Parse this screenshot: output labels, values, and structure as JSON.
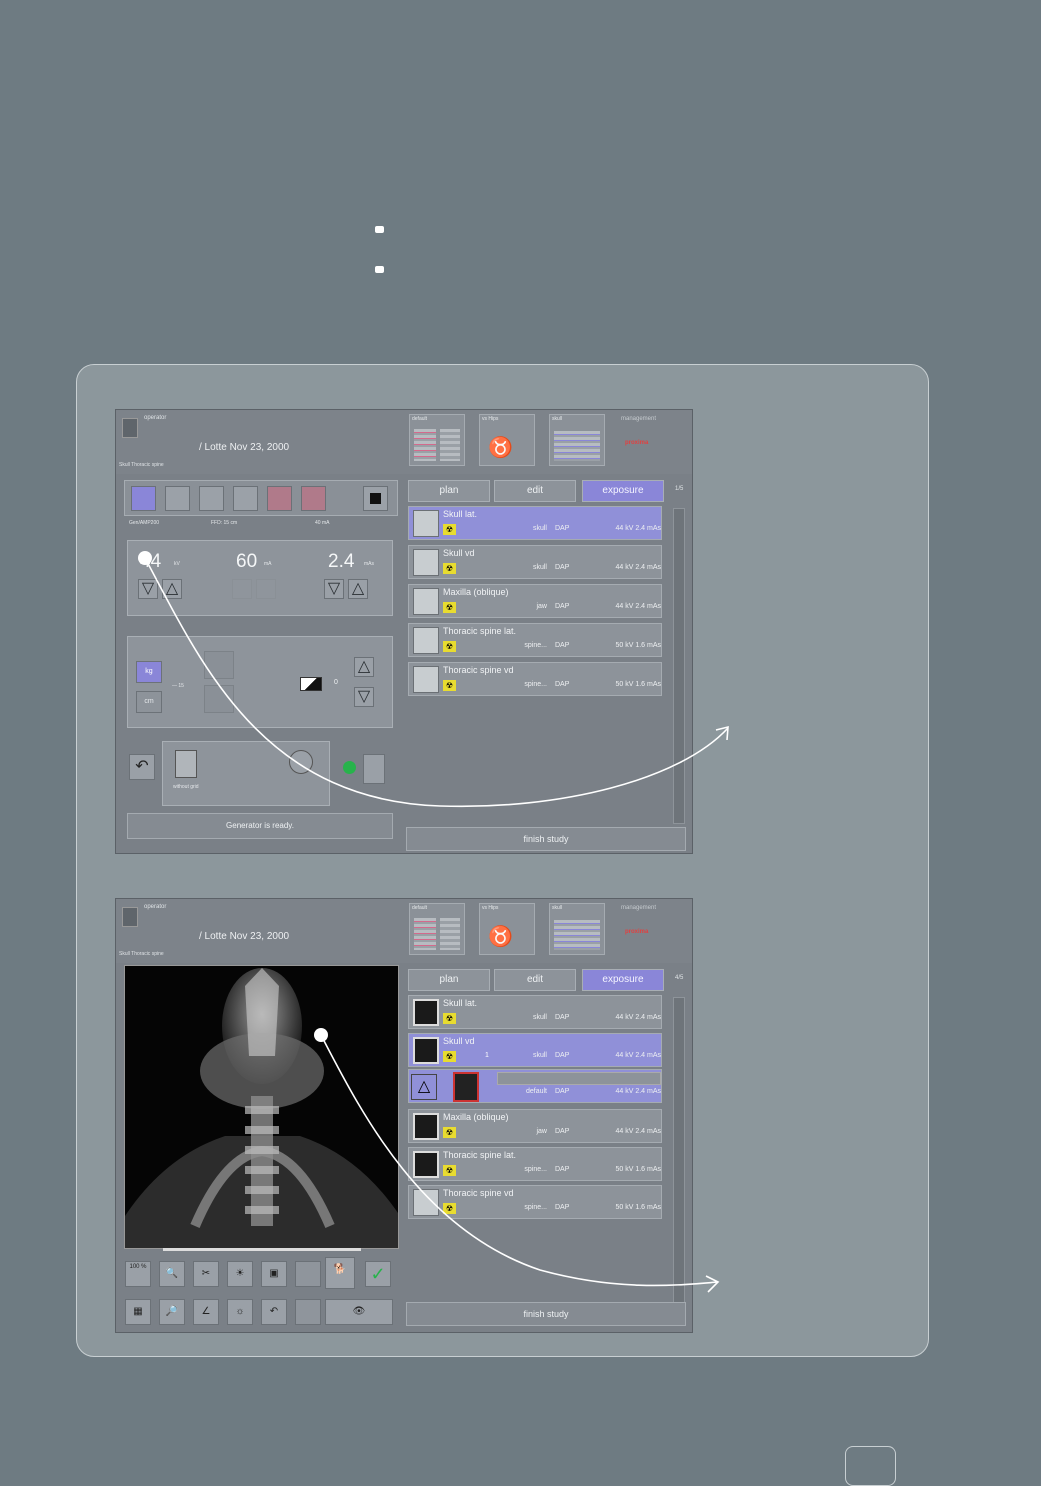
{
  "bullets": [
    "",
    ""
  ],
  "screen1": {
    "operator": "operator",
    "patient": "/ Lotte  Nov 23, 2000",
    "study": "Skull Thoracic spine",
    "thumb_labels": [
      "default",
      "vs Hips",
      "skull"
    ],
    "management": "management",
    "brand": "proxima",
    "tabs": [
      "plan",
      "edit",
      "exposure"
    ],
    "active_tab": "exposure",
    "page_count": "1/5",
    "lens_labels": [
      "Gen/AMP200",
      "FFD: 15 cm",
      "40 mA"
    ],
    "kv": "44",
    "kv_unit": "kV",
    "ma": "60",
    "ma_unit": "mA",
    "mas": "2.4",
    "mas_unit": "mAs",
    "units": [
      "kg",
      "cm"
    ],
    "thickness_label": "— 15",
    "density": "0",
    "technique_label": "without grid",
    "generator_status": "Generator is ready.",
    "items": [
      {
        "name": "Skull lat.",
        "region": "skull",
        "dap": "DAP",
        "kv": "44 kV 2.4 mAs",
        "selected": true
      },
      {
        "name": "Skull vd",
        "region": "skull",
        "dap": "DAP",
        "kv": "44 kV 2.4 mAs",
        "selected": false
      },
      {
        "name": "Maxilla (oblique)",
        "region": "jaw",
        "dap": "DAP",
        "kv": "44 kV 2.4 mAs",
        "selected": false
      },
      {
        "name": "Thoracic spine lat.",
        "region": "spine...",
        "dap": "DAP",
        "kv": "50 kV 1.6 mAs",
        "selected": false
      },
      {
        "name": "Thoracic spine vd",
        "region": "spine...",
        "dap": "DAP",
        "kv": "50 kV 1.6 mAs",
        "selected": false
      }
    ],
    "finish": "finish study"
  },
  "screen2": {
    "operator": "operator",
    "patient": "/ Lotte  Nov 23, 2000",
    "study": "Skull Thoracic spine",
    "thumb_labels": [
      "default",
      "vs Hips",
      "skull"
    ],
    "management": "management",
    "brand": "proxima",
    "tabs": [
      "plan",
      "edit",
      "exposure"
    ],
    "active_tab": "exposure",
    "page_count": "4/5",
    "zoom_label": "100 %",
    "items": [
      {
        "name": "Skull lat.",
        "region": "skull",
        "dap": "DAP",
        "kv": "44 kV 2.4 mAs",
        "selected": false
      },
      {
        "name": "Skull vd",
        "region": "skull",
        "dap": "DAP",
        "kv": "44 kV 2.4 mAs",
        "selected": true,
        "index": "1"
      },
      {
        "name": "",
        "region": "default",
        "dap": "DAP",
        "kv": "44 kV 2.4 mAs",
        "selected": true
      },
      {
        "name": "Maxilla (oblique)",
        "region": "jaw",
        "dap": "DAP",
        "kv": "44 kV 2.4 mAs",
        "selected": false
      },
      {
        "name": "Thoracic spine lat.",
        "region": "spine...",
        "dap": "DAP",
        "kv": "50 kV 1.6 mAs",
        "selected": false
      },
      {
        "name": "Thoracic spine vd",
        "region": "spine...",
        "dap": "DAP",
        "kv": "50 kV 1.6 mAs",
        "selected": false
      }
    ],
    "finish": "finish study"
  },
  "page_number": ""
}
